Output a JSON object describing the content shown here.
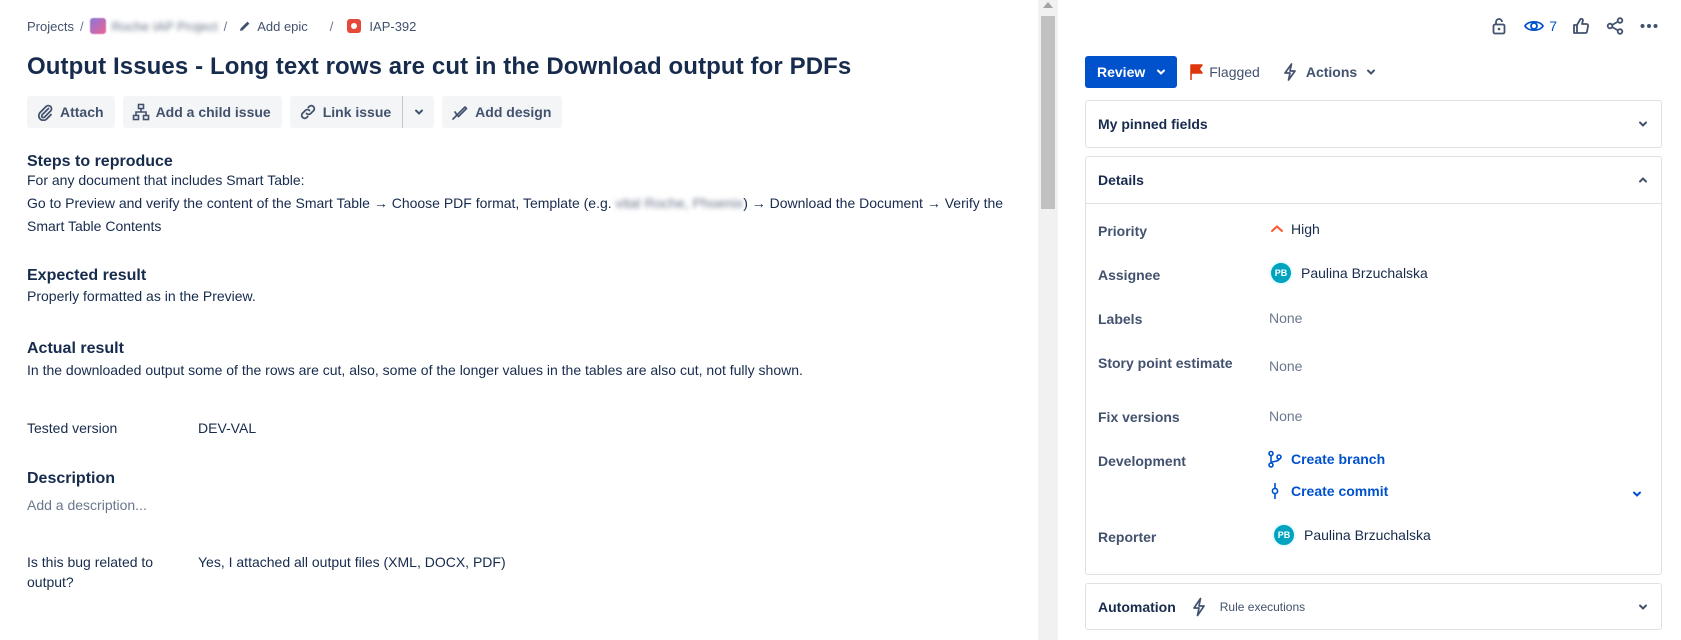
{
  "breadcrumb": {
    "projects": "Projects",
    "project_name": "Roche IAP Project",
    "add_epic": "Add epic",
    "issue_key": "IAP-392"
  },
  "issue": {
    "title": "Output Issues - Long text rows are cut in the Download output for PDFs"
  },
  "toolbar": {
    "attach": "Attach",
    "add_child": "Add a child issue",
    "link_issue": "Link issue",
    "add_design": "Add design"
  },
  "content": {
    "steps_heading": "Steps to reproduce",
    "steps_line1": "For any document that includes Smart Table:",
    "steps_line2_a": "Go to Preview and verify the content of the Smart Table → Choose PDF format, Template (e.g. ",
    "steps_line2_blur": "vital Roche, Phoenix",
    "steps_line2_b": ") → Download the Document → Verify the",
    "steps_line3": "Smart Table Contents",
    "expected_heading": "Expected result",
    "expected_text": "Properly formatted as in the Preview.",
    "actual_heading": "Actual result",
    "actual_text": "In the downloaded output some of the rows are cut, also, some of the longer values in the tables are also cut, not fully shown.",
    "tested_version_label": "Tested version",
    "tested_version_value": "DEV-VAL",
    "description_heading": "Description",
    "description_placeholder": "Add a description...",
    "bug_related_label": "Is this bug related to output?",
    "bug_related_value": "Yes, I attached all output files (XML, DOCX, PDF)"
  },
  "header_right": {
    "watch_count": "7"
  },
  "status": {
    "review": "Review",
    "flagged": "Flagged",
    "actions": "Actions"
  },
  "pinned": {
    "title": "My pinned fields"
  },
  "details": {
    "title": "Details",
    "priority_label": "Priority",
    "priority_value": "High",
    "assignee_label": "Assignee",
    "assignee_initials": "PB",
    "assignee_name": "Paulina Brzuchalska",
    "labels_label": "Labels",
    "labels_value": "None",
    "story_points_label": "Story point estimate",
    "story_points_value": "None",
    "fix_versions_label": "Fix versions",
    "fix_versions_value": "None",
    "development_label": "Development",
    "create_branch": "Create branch",
    "create_commit": "Create commit",
    "reporter_label": "Reporter",
    "reporter_initials": "PB",
    "reporter_name": "Paulina Brzuchalska"
  },
  "automation": {
    "title": "Automation",
    "rule_executions": "Rule executions"
  },
  "colors": {
    "primary": "#0052cc",
    "priority_high": "#ff5630",
    "flag": "#de350b",
    "avatar": "#00a3bf"
  }
}
